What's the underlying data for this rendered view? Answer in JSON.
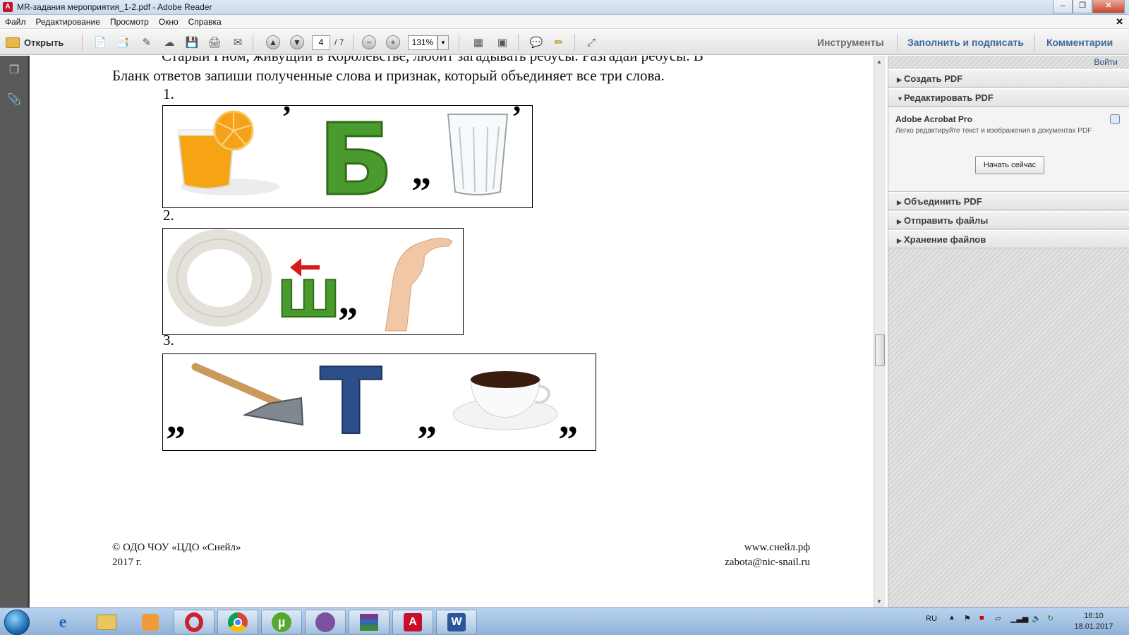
{
  "window": {
    "title": "MR-задания мероприятия_1-2.pdf - Adobe Reader"
  },
  "menu": [
    "Файл",
    "Редактирование",
    "Просмотр",
    "Окно",
    "Справка"
  ],
  "toolbar": {
    "open_label": "Открыть",
    "page_current": "4",
    "page_total": "/ 7",
    "zoom": "131%",
    "tools_label": "Инструменты",
    "fill_sign_label": "Заполнить и подписать",
    "comments_label": "Комментарии"
  },
  "document": {
    "intro_line1": "Старый Гном, живущий в Королевстве, любит загадывать ребусы. Разгадай ребусы. В",
    "intro_line2": "Бланк ответов запиши полученные слова и признак, который объединяет все три слова.",
    "rebus_numbers": [
      "1.",
      "2.",
      "3."
    ],
    "rebus2_letter": "Ш",
    "rebus3_letter": "Т",
    "rebus1_letter": "Б",
    "footer_left_line1": "© ОДО ЧОУ «ЦДО «Снейл»",
    "footer_left_line2": "2017 г.",
    "footer_right_line1": "www.снейл.рф",
    "footer_right_line2": "zabota@nic-snail.ru"
  },
  "right_panel": {
    "sign_in": "Войти",
    "sections": [
      "Создать PDF",
      "Редактировать PDF",
      "Объединить PDF",
      "Отправить файлы",
      "Хранение файлов"
    ],
    "product_name": "Adobe Acrobat Pro",
    "product_desc": "Легко редактируйте текст и изображения в документах PDF",
    "start_button": "Начать сейчас"
  },
  "taskbar": {
    "language": "RU",
    "time": "16:10",
    "date": "18.01.2017",
    "apps": [
      "ie-icon",
      "explorer-icon",
      "media-player-icon",
      "opera-icon",
      "chrome-icon",
      "utorrent-icon",
      "viber-icon",
      "winrar-icon",
      "adobe-reader-icon",
      "word-icon"
    ]
  },
  "colors": {
    "accent_blue": "#3c6a9a",
    "plasticine_green": "#4a9a2e",
    "plasticine_blue": "#2c4f8a",
    "arrow_red": "#d61a1a"
  }
}
